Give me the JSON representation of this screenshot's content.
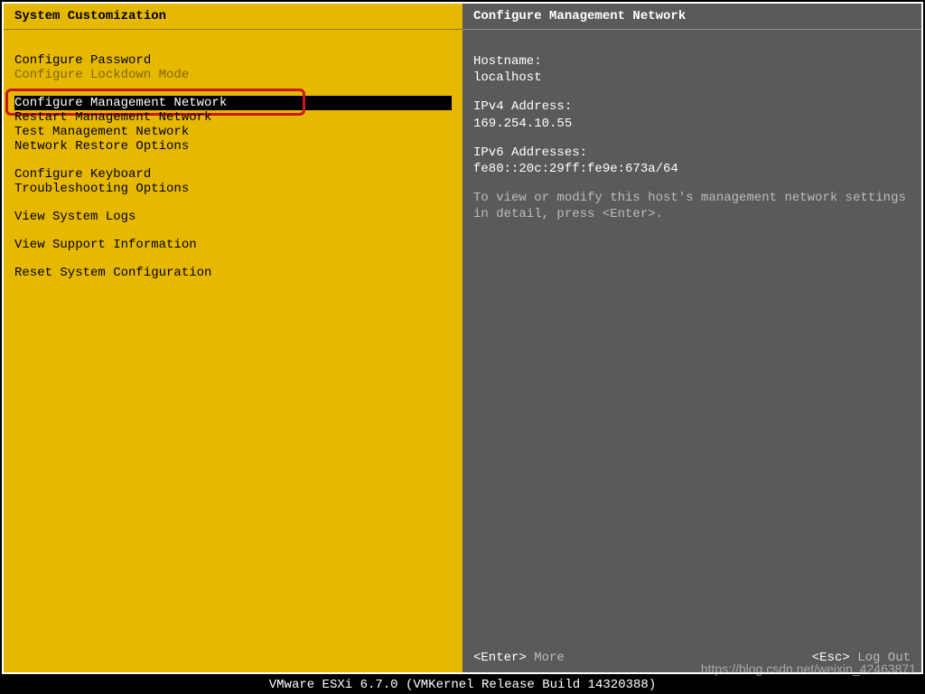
{
  "left": {
    "title": "System Customization",
    "groups": [
      {
        "items": [
          {
            "label": "Configure Password",
            "selected": false,
            "disabled": false
          },
          {
            "label": "Configure Lockdown Mode",
            "selected": false,
            "disabled": true
          }
        ]
      },
      {
        "items": [
          {
            "label": "Configure Management Network",
            "selected": true,
            "disabled": false,
            "annotated": true
          },
          {
            "label": "Restart Management Network",
            "selected": false,
            "disabled": false
          },
          {
            "label": "Test Management Network",
            "selected": false,
            "disabled": false
          },
          {
            "label": "Network Restore Options",
            "selected": false,
            "disabled": false
          }
        ]
      },
      {
        "items": [
          {
            "label": "Configure Keyboard",
            "selected": false,
            "disabled": false
          },
          {
            "label": "Troubleshooting Options",
            "selected": false,
            "disabled": false
          }
        ]
      },
      {
        "items": [
          {
            "label": "View System Logs",
            "selected": false,
            "disabled": false
          }
        ]
      },
      {
        "items": [
          {
            "label": "View Support Information",
            "selected": false,
            "disabled": false
          }
        ]
      },
      {
        "items": [
          {
            "label": "Reset System Configuration",
            "selected": false,
            "disabled": false
          }
        ]
      }
    ]
  },
  "right": {
    "title": "Configure Management Network",
    "hostname_label": "Hostname:",
    "hostname_value": "localhost",
    "ipv4_label": "IPv4 Address:",
    "ipv4_value": "169.254.10.55",
    "ipv6_label": "IPv6 Addresses:",
    "ipv6_value": "fe80::20c:29ff:fe9e:673a/64",
    "hint": "To view or modify this host's management network settings in detail, press <Enter>.",
    "footer": {
      "enter_key": "<Enter>",
      "enter_label": "More",
      "esc_key": "<Esc>",
      "esc_label": "Log Out"
    }
  },
  "status_bar": "VMware ESXi 6.7.0 (VMKernel Release Build 14320388)",
  "watermark": "https://blog.csdn.net/weixin_42463871"
}
